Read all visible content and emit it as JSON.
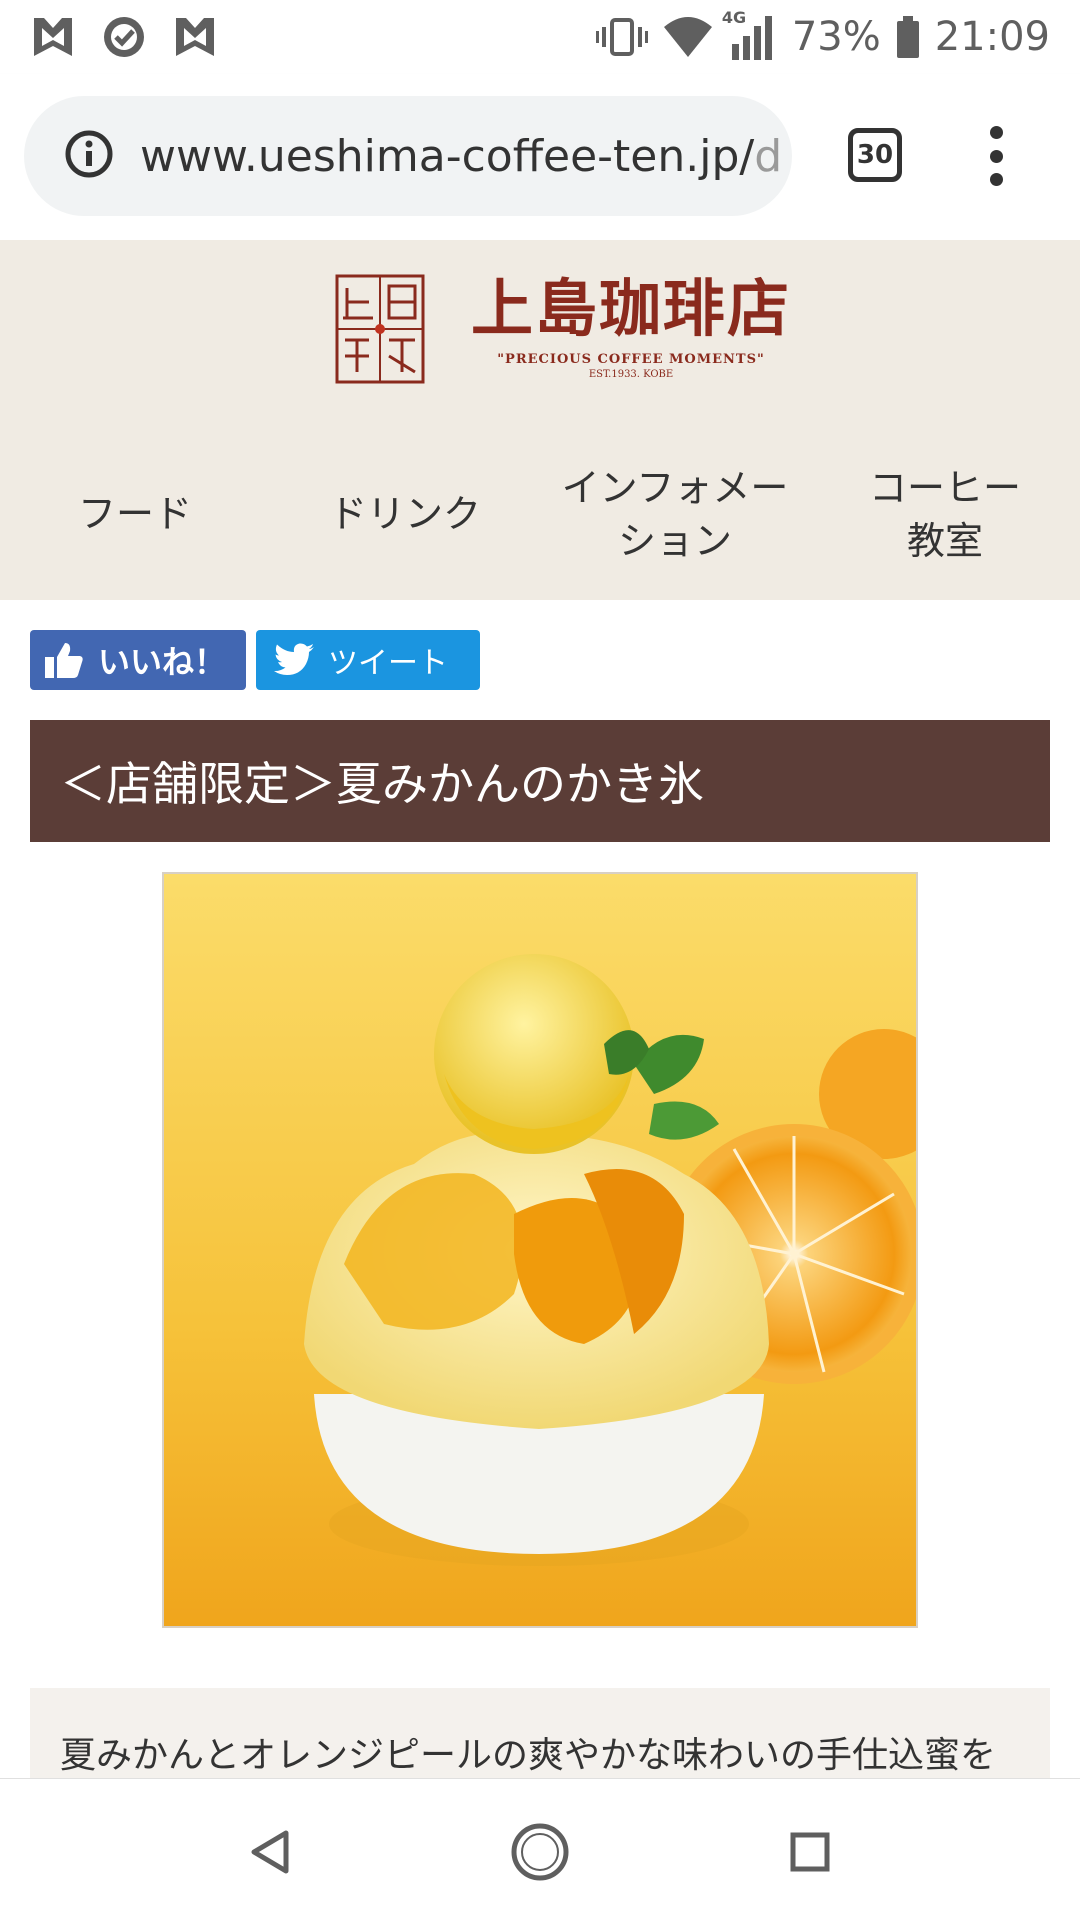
{
  "status_bar": {
    "battery": "73%",
    "time": "21:09",
    "network": "4G"
  },
  "browser": {
    "url_main": "www.ueshima-coffee-ten.jp/",
    "url_faded": "d",
    "tab_count": "30"
  },
  "site": {
    "logo_name": "上島珈琲店",
    "logo_tagline": "\"PRECIOUS COFFEE MOMENTS\"",
    "logo_est": "EST.1933. KOBE",
    "nav": [
      {
        "label": "フード"
      },
      {
        "label": "ドリンク"
      },
      {
        "label": "インフォメー\nション"
      },
      {
        "label": "コーヒー\n教室"
      }
    ]
  },
  "share": {
    "like_label": "いいね！",
    "tweet_label": "ツイート"
  },
  "article": {
    "title": "＜店舗限定＞夏みかんのかき氷",
    "description": "夏みかんとオレンジピールの爽やかな味わいの手仕込蜜を"
  },
  "colors": {
    "header_bg": "#f0ebe3",
    "title_bg": "#5b3d37",
    "logo_red": "#8a2a1d",
    "facebook_blue": "#4267b2",
    "twitter_blue": "#1b95e0"
  }
}
